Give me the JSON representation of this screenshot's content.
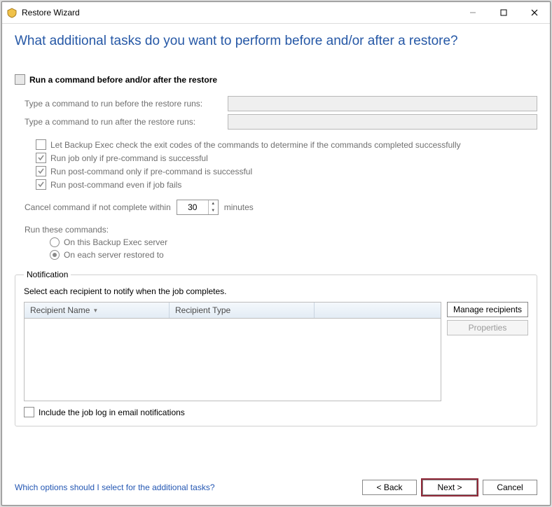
{
  "window": {
    "title": "Restore Wizard"
  },
  "heading": "What additional tasks do you want to perform before and/or after a restore?",
  "runCommand": {
    "label": "Run a command before and/or after the restore",
    "checked": false,
    "beforeLabel": "Type a command to run before the restore runs:",
    "beforeValue": "",
    "afterLabel": "Type a command to run after the restore runs:",
    "afterValue": "",
    "checkExit": {
      "label": "Let Backup Exec check the exit codes of the commands to determine if the commands completed successfully",
      "checked": false
    },
    "runIfPre": {
      "label": "Run job only if pre-command is successful",
      "checked": true
    },
    "postIfPre": {
      "label": "Run post-command only if pre-command is successful",
      "checked": true
    },
    "postIfFail": {
      "label": "Run post-command even if job fails",
      "checked": true
    },
    "cancelLabelLeft": "Cancel command if not complete within",
    "cancelValue": "30",
    "cancelLabelRight": "minutes",
    "runTheseLabel": "Run these commands:",
    "radioThisServer": "On this Backup Exec server",
    "radioEachServer": "On each server restored to",
    "radioSelected": "each"
  },
  "notification": {
    "legend": "Notification",
    "prompt": "Select each recipient to notify when the job completes.",
    "columns": {
      "name": "Recipient Name",
      "type": "Recipient Type"
    },
    "manageBtn": "Manage recipients",
    "propsBtn": "Properties",
    "includeLog": {
      "label": "Include the job log in email notifications",
      "checked": false
    }
  },
  "footer": {
    "helpLink": "Which options should I select for the additional tasks?",
    "back": "< Back",
    "next": "Next >",
    "cancel": "Cancel"
  }
}
